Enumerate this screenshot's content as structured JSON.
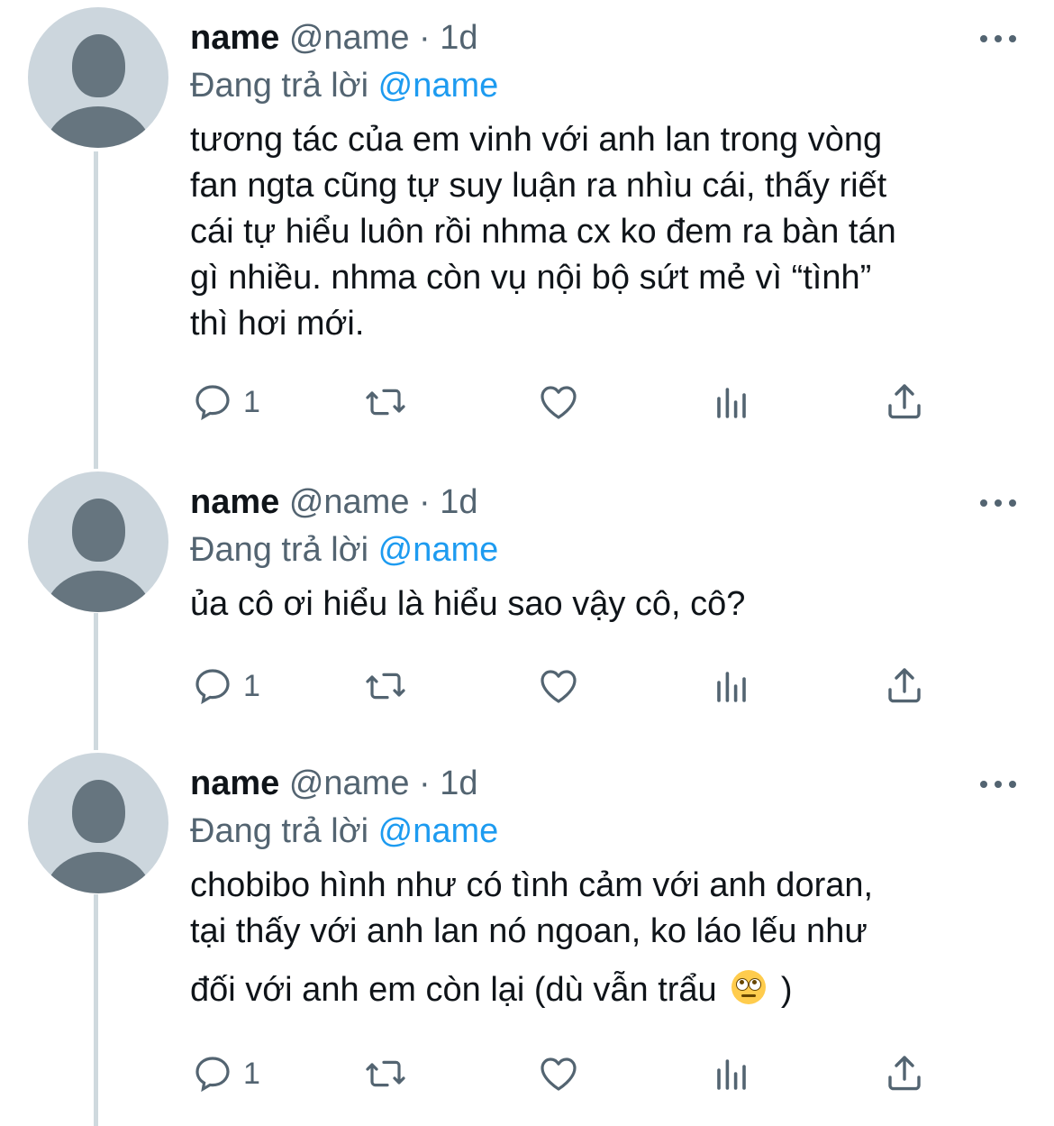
{
  "tweets": [
    {
      "name": "name",
      "handle": "@name",
      "separator": "·",
      "time": "1d",
      "replying_prefix": "Đang trả lời",
      "replying_to": "@name",
      "text_lines": [
        "tương tác của em vinh với anh lan trong vòng",
        "fan ngta cũng tự suy luận ra nhìu cái, thấy riết",
        "cái tự hiểu luôn rồi nhma cx ko đem ra bàn tán",
        "gì nhiều. nhma còn vụ nội bộ sứt mẻ vì “tình”",
        "thì hơi mới."
      ],
      "reply_count": "1"
    },
    {
      "name": "name",
      "handle": "@name",
      "separator": "·",
      "time": "1d",
      "replying_prefix": "Đang trả lời",
      "replying_to": "@name",
      "text_lines": [
        "ủa cô ơi hiểu là hiểu sao vậy cô, cô?"
      ],
      "reply_count": "1"
    },
    {
      "name": "name",
      "handle": "@name",
      "separator": "·",
      "time": "1d",
      "replying_prefix": "Đang trả lời",
      "replying_to": "@name",
      "text_lines": [
        "chobibo hình như có tình cảm với anh doran,",
        "tại thấy với anh lan nó ngoan, ko láo lếu như",
        "đối với anh em còn lại (dù vẫn trẩu",
        ")"
      ],
      "emoji": "face-with-rolling-eyes",
      "reply_count": "1"
    }
  ],
  "icons": {
    "reply": "reply-icon",
    "retweet": "retweet-icon",
    "like": "heart-icon",
    "analytics": "analytics-icon",
    "share": "share-icon",
    "more": "more-icon"
  },
  "colors": {
    "text": "#0f1419",
    "secondary": "#536471",
    "link": "#1d9bf0",
    "avatar_bg": "#ccd6dd",
    "avatar_fg": "#66757f",
    "thread_line": "#cfd9de"
  }
}
